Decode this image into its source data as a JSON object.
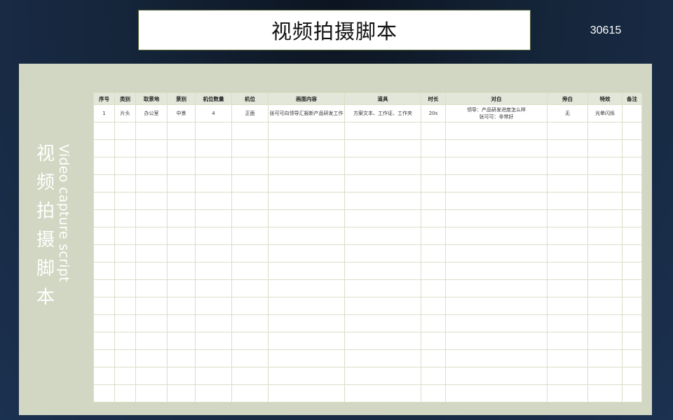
{
  "header": {
    "title": "视频拍摄脚本",
    "number": "30615"
  },
  "sidebar": {
    "title_cn": [
      "视",
      "频",
      "拍",
      "摄",
      "脚",
      "本"
    ],
    "title_en": "Video capture script"
  },
  "table": {
    "columns": [
      "序号",
      "类别",
      "取景地",
      "景别",
      "机位数量",
      "机位",
      "画面内容",
      "道具",
      "时长",
      "对白",
      "旁白",
      "特效",
      "备注"
    ],
    "rows": [
      [
        "1",
        "片头",
        "办公室",
        "中景",
        "4",
        "正面",
        "张可可向领导汇报新产品研发工作",
        "方案文本、工作证、工作夹",
        "20s",
        "领导：产品研发进度怎么样\n张可可：非常好",
        "无",
        "光晕闪烁",
        ""
      ]
    ],
    "empty_rows": 16
  }
}
